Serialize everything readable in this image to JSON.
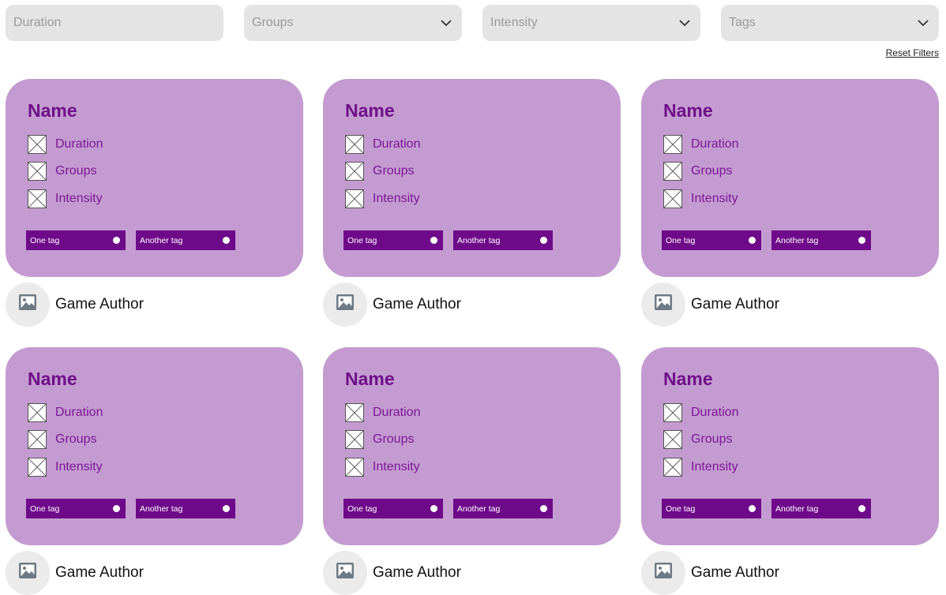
{
  "filters": [
    {
      "placeholder": "Duration",
      "has_dropdown": false
    },
    {
      "placeholder": "Groups",
      "has_dropdown": true
    },
    {
      "placeholder": "Intensity",
      "has_dropdown": true
    },
    {
      "placeholder": "Tags",
      "has_dropdown": true
    }
  ],
  "reset_label": "Reset Filters",
  "colors": {
    "card_bg": "#c49bd1",
    "accent": "#6e0f88",
    "tag_bg": "#6e0a89",
    "filter_bg": "#e4e4e4"
  },
  "cards": [
    {
      "name": "Name",
      "props": [
        "Duration",
        "Groups",
        "Intensity"
      ],
      "tags": [
        "One tag",
        "Another tag"
      ],
      "author": "Game Author"
    },
    {
      "name": "Name",
      "props": [
        "Duration",
        "Groups",
        "Intensity"
      ],
      "tags": [
        "One tag",
        "Another tag"
      ],
      "author": "Game Author"
    },
    {
      "name": "Name",
      "props": [
        "Duration",
        "Groups",
        "Intensity"
      ],
      "tags": [
        "One tag",
        "Another tag"
      ],
      "author": "Game Author"
    },
    {
      "name": "Name",
      "props": [
        "Duration",
        "Groups",
        "Intensity"
      ],
      "tags": [
        "One tag",
        "Another tag"
      ],
      "author": "Game Author"
    },
    {
      "name": "Name",
      "props": [
        "Duration",
        "Groups",
        "Intensity"
      ],
      "tags": [
        "One tag",
        "Another tag"
      ],
      "author": "Game Author"
    },
    {
      "name": "Name",
      "props": [
        "Duration",
        "Groups",
        "Intensity"
      ],
      "tags": [
        "One tag",
        "Another tag"
      ],
      "author": "Game Author"
    }
  ]
}
